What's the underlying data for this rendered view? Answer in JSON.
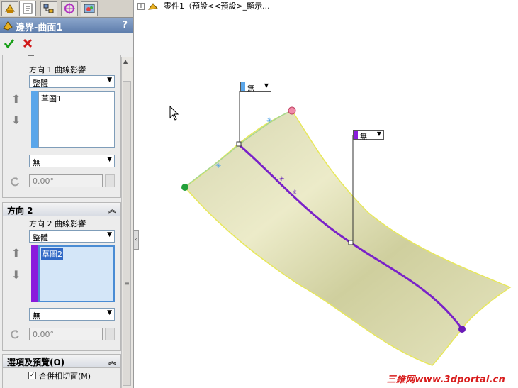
{
  "tabs": [
    {
      "icon": "feature-manager-icon"
    },
    {
      "icon": "property-manager-icon"
    },
    {
      "icon": "configuration-manager-icon"
    },
    {
      "icon": "dimxpert-icon"
    },
    {
      "icon": "display-manager-icon"
    }
  ],
  "panel": {
    "title": "邊界-曲面1",
    "help": "?",
    "ok_icon": "checkmark-icon",
    "cancel_icon": "cross-icon"
  },
  "direction1": {
    "influence_label": "方向 1 曲線影響",
    "influence_value": "整體",
    "list_items": [
      "草圖1"
    ],
    "tangent_value": "無",
    "angle_value": "0.00°",
    "color": "#5aa6ea"
  },
  "direction2": {
    "header": "方向 2",
    "influence_label": "方向 2 曲線影響",
    "influence_value": "整體",
    "list_items": [
      "草圖2"
    ],
    "tangent_value": "無",
    "angle_value": "0.00°",
    "color": "#8a1cdc"
  },
  "options": {
    "header": "選項及預覽(O)",
    "merge_label": "合併相切面(M)",
    "merge_checked": true
  },
  "tree": {
    "label": "零件1（預設<<預設>_顯示..."
  },
  "callouts": [
    {
      "value": "無",
      "color": "#5aa6ea"
    },
    {
      "value": "無",
      "color": "#8a1cdc"
    }
  ],
  "watermark": "三維网www.3dportal.cn"
}
